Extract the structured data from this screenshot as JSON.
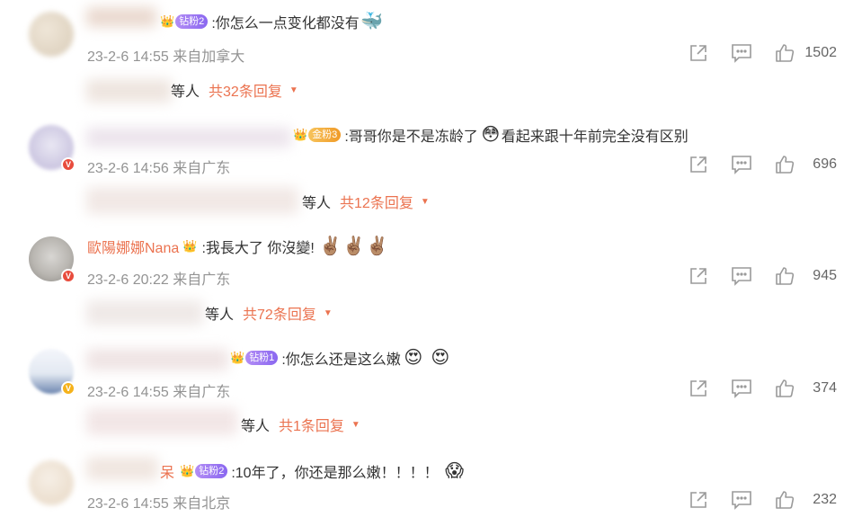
{
  "comments": [
    {
      "fan_tag": "钻粉2",
      "text": ":你怎么一点变化都没有",
      "emojis": [
        "🐳"
      ],
      "time": "23-2-6 14:55",
      "location": "来自加拿大",
      "likes": "1502",
      "replies": {
        "who": "等人",
        "total": "共32条回复"
      }
    },
    {
      "fan_tag": "金粉3",
      "text_before": ":哥哥你是不是冻龄了",
      "emojis": [
        "😳"
      ],
      "text_after": "看起来跟十年前完全没有区别",
      "time": "23-2-6 14:56",
      "location": "来自广东",
      "likes": "696",
      "replies": {
        "who": "等人",
        "total": "共12条回复"
      }
    },
    {
      "username": "歐陽娜娜Nana",
      "text": ":我長大了 你沒變!",
      "emojis": [
        "✌🏽",
        "✌🏽",
        "✌🏽"
      ],
      "time": "23-2-6 20:22",
      "location": "来自广东",
      "likes": "945",
      "replies": {
        "who": "等人",
        "total": "共72条回复"
      }
    },
    {
      "fan_tag": "钻粉1",
      "text": ":你怎么还是这么嫩",
      "emojis": [
        "😍",
        "😍"
      ],
      "time": "23-2-6 14:55",
      "location": "来自广东",
      "likes": "374",
      "replies": {
        "who": "等人",
        "total": "共1条回复"
      }
    },
    {
      "username_partial": "呆",
      "fan_tag": "钻粉2",
      "text": ":10年了，你还是那么嫩！！！！",
      "emojis": [
        "😱"
      ],
      "time": "23-2-6 14:55",
      "location": "来自北京",
      "likes": "232"
    }
  ],
  "colors": {
    "accent": "#eb7350",
    "meta": "#939393",
    "icon": "#9a9a9a"
  },
  "icons": {
    "share": "share-icon",
    "reply": "comment-icon",
    "like": "thumbs-up-icon",
    "more": "caret-down-icon"
  }
}
